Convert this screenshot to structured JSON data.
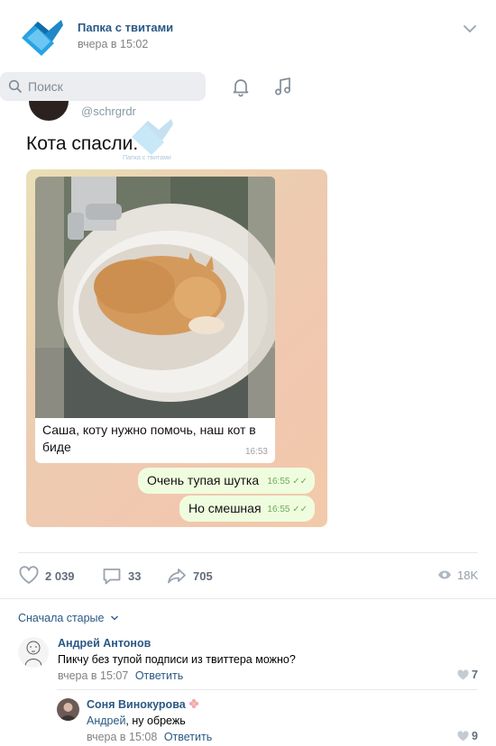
{
  "header": {
    "group_name": "Папка с твитами",
    "post_time": "вчера в 15:02"
  },
  "search": {
    "placeholder": "Поиск"
  },
  "post": {
    "tweet_handle": "@schrgrdr",
    "watermark_text": "Папка с твитами",
    "tweet_text": "Кота спасли.",
    "chat": {
      "incoming_text": "Саша, коту нужно помочь, наш кот в биде",
      "incoming_time": "16:53",
      "outgoing": [
        {
          "text": "Очень тупая шутка",
          "time": "16:55"
        },
        {
          "text": "Но смешная",
          "time": "16:55"
        }
      ]
    }
  },
  "actions": {
    "likes": "2 039",
    "comments": "33",
    "shares": "705",
    "views": "18K"
  },
  "comments_section": {
    "sort_label": "Сначала старые",
    "items": [
      {
        "author": "Андрей Антонов",
        "text": "Пикчу без тупой подписи из твиттера можно?",
        "time": "вчера в 15:07",
        "reply_label": "Ответить",
        "likes": "7"
      },
      {
        "author": "Соня Винокурова",
        "mention": "Андрей",
        "text_rest": ", ну обрежь",
        "time": "вчера в 15:08",
        "reply_label": "Ответить",
        "likes": "9"
      }
    ]
  },
  "colors": {
    "link": "#2a5885",
    "muted": "#828282",
    "action": "#626d7a",
    "search_bg": "#ebedf0",
    "outgoing_bubble": "#effdde"
  },
  "icons": [
    "folder-icon",
    "chevron-down-icon",
    "search-icon",
    "bell-icon",
    "music-icon",
    "heart-icon",
    "comment-icon",
    "share-icon",
    "eye-icon",
    "flower-icon"
  ]
}
